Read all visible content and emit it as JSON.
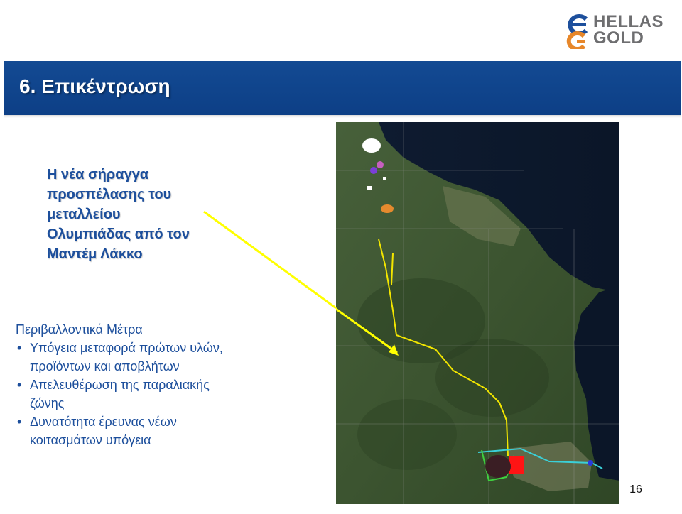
{
  "logo": {
    "text_line1": "HELLAS",
    "text_line2": "GOLD"
  },
  "title": "6.  Επικέντρωση",
  "headline": {
    "lines": [
      "Η νέα σήραγγα",
      "προσπέλασης του",
      "μεταλλείου",
      "Ολυμπιάδας από τον",
      "Μαντέμ Λάκκο"
    ]
  },
  "measures": {
    "heading": "Περιβαλλοντικά Μέτρα",
    "items": [
      {
        "line1": "Υπόγεια μεταφορά πρώτων υλών,",
        "line2": "προϊόντων και αποβλήτων"
      },
      {
        "line1": "Απελευθέρωση της παραλιακής",
        "line2": "ζώνης"
      },
      {
        "line1": "Δυνατότητα έρευνας νέων",
        "line2": "κοιτασμάτων υπόγεια"
      }
    ]
  },
  "page_number": "16",
  "colors": {
    "title_band": "#134a93",
    "text_blue": "#1d4f9c",
    "pointer_line": "#ffff00"
  }
}
